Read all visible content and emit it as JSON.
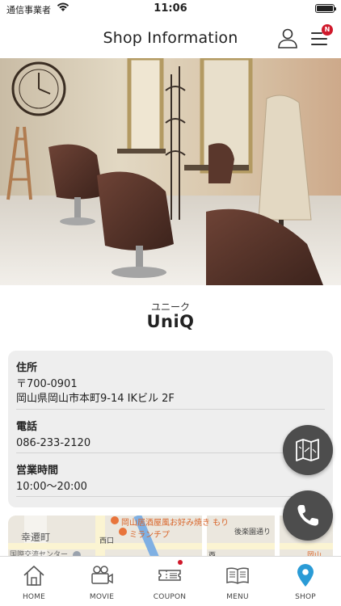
{
  "status_bar": {
    "carrier": "通信事業者",
    "time": "11:06"
  },
  "header": {
    "title": "Shop Information",
    "menu_badge": "N"
  },
  "shop": {
    "kana": "ユニーク",
    "name": "UniQ"
  },
  "info": {
    "address_label": "住所",
    "postal": "〒700-0901",
    "address": "岡山県岡山市本町9-14 IKビル 2F",
    "phone_label": "電話",
    "phone": "086-233-2120",
    "hours_label": "営業時間",
    "hours": "10:00〜20:00"
  },
  "map": {
    "label_izakaya": "岡山居酒屋風お好み焼き もり",
    "label_lunch": "ミランチプ",
    "label_town": "幸遷町",
    "label_park": "後楽園通り",
    "label_center": "国際交流センター",
    "label_nishi": "西口",
    "label_west": "西",
    "label_okayama": "岡山"
  },
  "tabs": [
    {
      "label": "HOME",
      "icon": "home-icon"
    },
    {
      "label": "MOVIE",
      "icon": "movie-camera-icon"
    },
    {
      "label": "COUPON",
      "icon": "coupon-icon"
    },
    {
      "label": "MENU",
      "icon": "book-icon"
    },
    {
      "label": "SHOP",
      "icon": "map-pin-icon"
    }
  ],
  "colors": {
    "accent": "#2a9bd6",
    "badge": "#d0192b",
    "fab": "#4d4d4d",
    "card": "#eeeeee"
  }
}
